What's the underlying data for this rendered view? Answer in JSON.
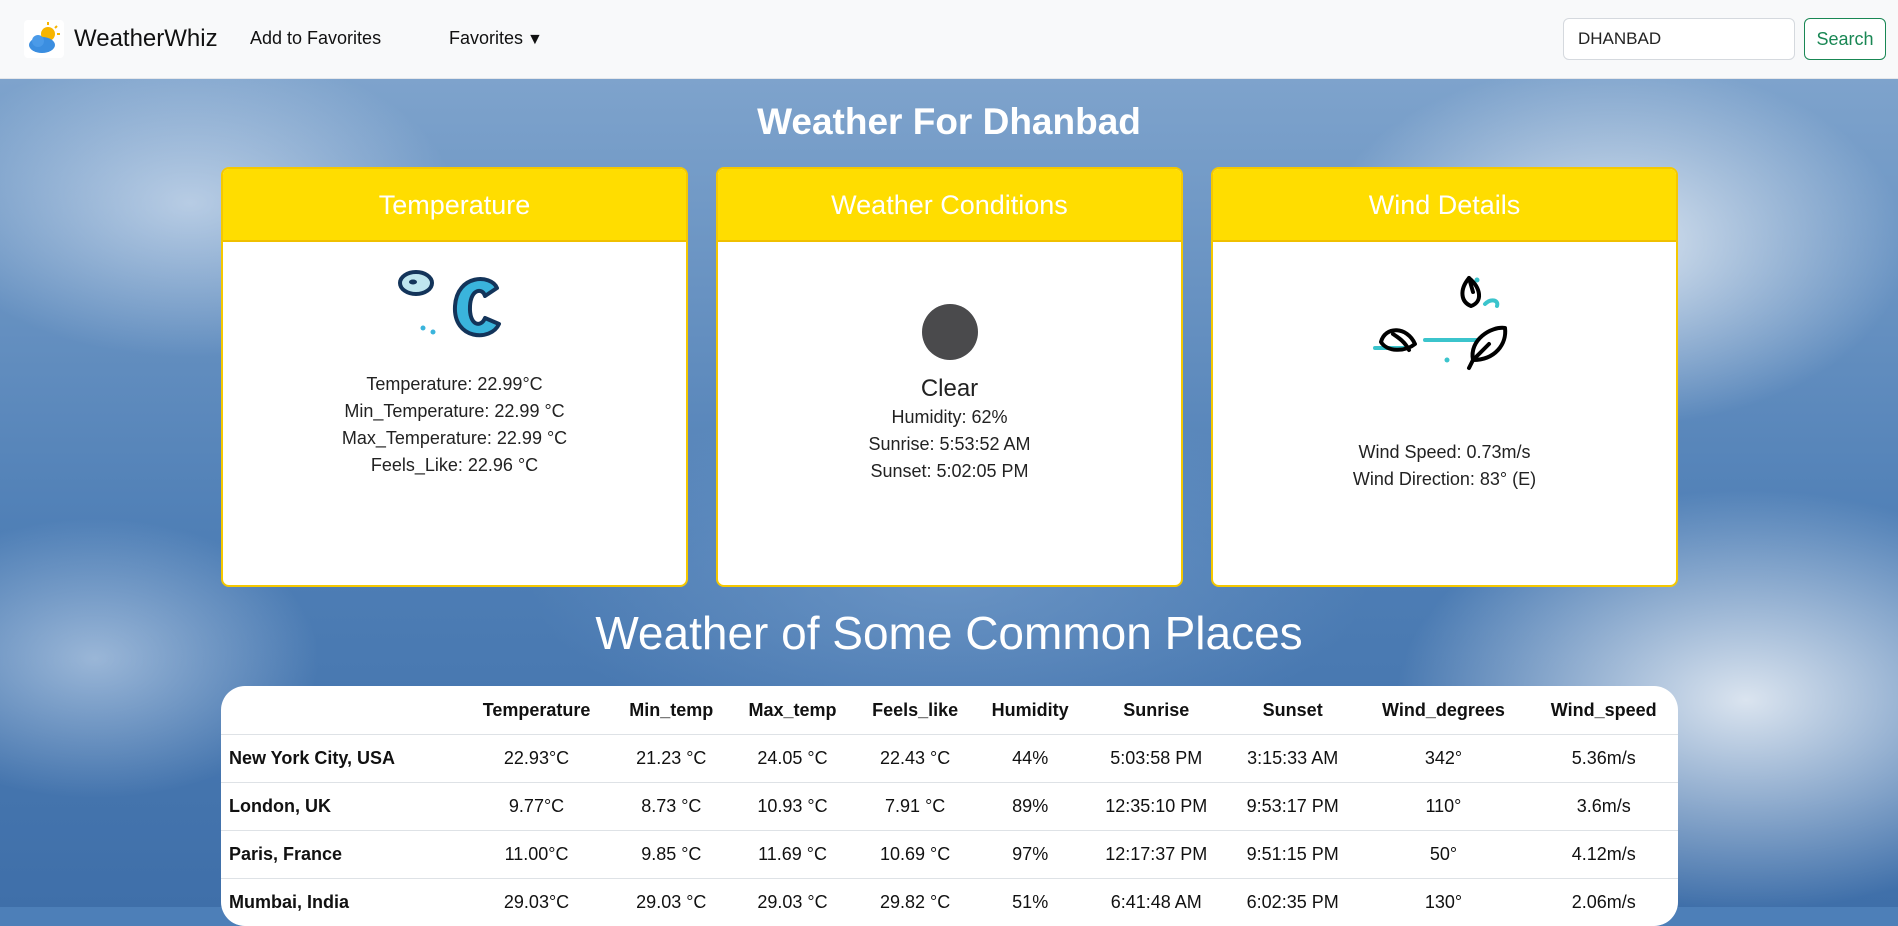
{
  "navbar": {
    "brand": "WeatherWhiz",
    "add_favorites": "Add to Favorites",
    "favorites": "Favorites",
    "search_value": "DHANBAD",
    "search_button": "Search"
  },
  "page_title": "Weather For Dhanbad",
  "cards": {
    "temperature": {
      "title": "Temperature",
      "icon": "celsius-icon",
      "lines": [
        "Temperature: 22.99°C",
        "Min_Temperature: 22.99 °C",
        "Max_Temperature: 22.99 °C",
        "Feels_Like: 22.96 °C"
      ]
    },
    "conditions": {
      "title": "Weather Conditions",
      "icon": "clear-weather-icon",
      "condition": "Clear",
      "lines": [
        "Humidity: 62%",
        "Sunrise: 5:53:52 AM",
        "Sunset: 5:02:05 PM"
      ]
    },
    "wind": {
      "title": "Wind Details",
      "icon": "wind-leaves-icon",
      "lines": [
        "Wind Speed: 0.73m/s",
        "Wind Direction: 83° (E)"
      ]
    }
  },
  "common_places": {
    "title": "Weather of Some Common Places",
    "columns": [
      "",
      "Temperature",
      "Min_temp",
      "Max_temp",
      "Feels_like",
      "Humidity",
      "Sunrise",
      "Sunset",
      "Wind_degrees",
      "Wind_speed"
    ],
    "rows": [
      [
        "New York City, USA",
        "22.93°C",
        "21.23 °C",
        "24.05 °C",
        "22.43 °C",
        "44%",
        "5:03:58 PM",
        "3:15:33 AM",
        "342°",
        "5.36m/s"
      ],
      [
        "London, UK",
        "9.77°C",
        "8.73 °C",
        "10.93 °C",
        "7.91 °C",
        "89%",
        "12:35:10 PM",
        "9:53:17 PM",
        "110°",
        "3.6m/s"
      ],
      [
        "Paris, France",
        "11.00°C",
        "9.85 °C",
        "11.69 °C",
        "10.69 °C",
        "97%",
        "12:17:37 PM",
        "9:51:15 PM",
        "50°",
        "4.12m/s"
      ],
      [
        "Mumbai, India",
        "29.03°C",
        "29.03 °C",
        "29.03 °C",
        "29.82 °C",
        "51%",
        "6:41:48 AM",
        "6:02:35 PM",
        "130°",
        "2.06m/s"
      ]
    ]
  },
  "colors": {
    "card_header": "#ffdd00",
    "search_button": "#198754",
    "condition_dot": "#4a4a4c"
  }
}
